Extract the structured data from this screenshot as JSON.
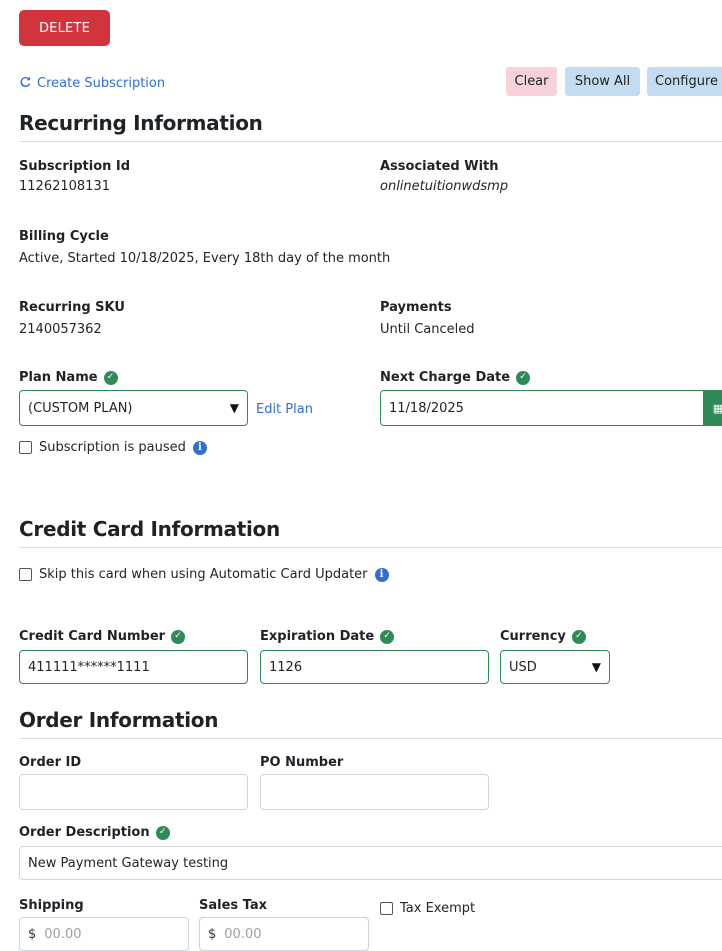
{
  "toolbar": {
    "delete_label": "DELETE",
    "create_subscription_label": "Create Subscription",
    "clear_label": "Clear",
    "show_all_label": "Show All",
    "configure_label": "Configure"
  },
  "recurring": {
    "title": "Recurring Information",
    "subscription_id_label": "Subscription Id",
    "subscription_id": "11262108131",
    "associated_with_label": "Associated With",
    "associated_with": "onlinetuitionwdsmp",
    "billing_cycle_label": "Billing Cycle",
    "billing_cycle": "Active, Started 10/18/2025, Every 18th day of the month",
    "recurring_sku_label": "Recurring SKU",
    "recurring_sku": "2140057362",
    "payments_label": "Payments",
    "payments": "Until Canceled",
    "plan_name_label": "Plan Name",
    "plan_name_value": "(CUSTOM PLAN)",
    "edit_plan_label": "Edit Plan",
    "next_charge_label": "Next Charge Date",
    "next_charge_value": "11/18/2025",
    "paused_label": "Subscription is paused"
  },
  "credit_card": {
    "title": "Credit Card Information",
    "skip_label": "Skip this card when using Automatic Card Updater",
    "number_label": "Credit Card Number",
    "number_value": "411111******1111",
    "expiration_label": "Expiration Date",
    "expiration_value": "1126",
    "currency_label": "Currency",
    "currency_value": "USD"
  },
  "order": {
    "title": "Order Information",
    "order_id_label": "Order ID",
    "order_id_value": "",
    "po_number_label": "PO Number",
    "po_number_value": "",
    "description_label": "Order Description",
    "description_value": "New Payment Gateway testing",
    "shipping_label": "Shipping",
    "shipping_currency": "$",
    "shipping_placeholder": "00.00",
    "sales_tax_label": "Sales Tax",
    "sales_tax_currency": "$",
    "sales_tax_placeholder": "00.00",
    "tax_exempt_label": "Tax Exempt"
  },
  "icons": {
    "refresh": "refresh-icon",
    "check": "check-circle-icon",
    "info": "info-circle-icon",
    "calendar": "calendar-icon",
    "chevron": "chevron-down-icon"
  },
  "colors": {
    "danger": "#d1343d",
    "success": "#2e8b57",
    "link": "#2f6fd3",
    "clear_bg": "#f8d2d8",
    "info_btn_bg": "#c4dcf1"
  }
}
